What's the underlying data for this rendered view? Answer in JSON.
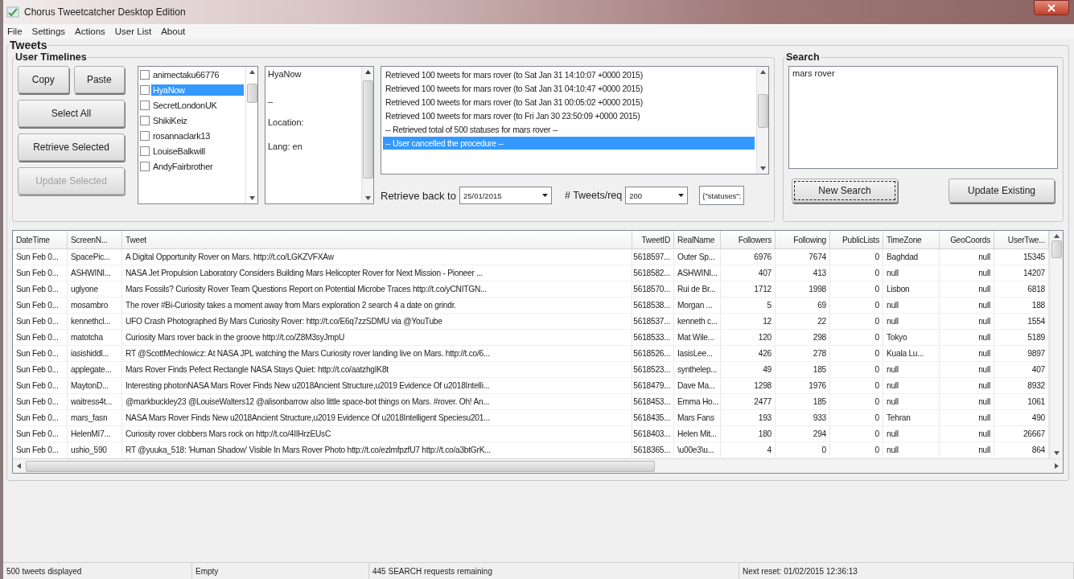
{
  "window": {
    "title": "Chorus Tweetcatcher Desktop Edition"
  },
  "menu": [
    {
      "label": "File"
    },
    {
      "label": "Settings"
    },
    {
      "label": "Actions"
    },
    {
      "label": "User List"
    },
    {
      "label": "About"
    }
  ],
  "tweets_group": {
    "title": "Tweets"
  },
  "user_timelines": {
    "title": "User Timelines",
    "buttons": [
      {
        "label": "Copy",
        "disabled": false
      },
      {
        "label": "Paste",
        "disabled": false
      },
      {
        "label": "Select All",
        "disabled": false
      },
      {
        "label": "Retrieve Selected",
        "disabled": false
      },
      {
        "label": "Update Selected",
        "disabled": true
      }
    ],
    "users": [
      {
        "name": "animectaku66776",
        "checked": false,
        "selected": false
      },
      {
        "name": "HyaNow",
        "checked": false,
        "selected": true
      },
      {
        "name": "SecretLondonUK",
        "checked": false,
        "selected": false
      },
      {
        "name": "ShikiKeiz",
        "checked": false,
        "selected": false
      },
      {
        "name": "rosannaclark13",
        "checked": false,
        "selected": false
      },
      {
        "name": "LouiseBalkwill",
        "checked": false,
        "selected": false
      },
      {
        "name": "AndyFairbrother",
        "checked": false,
        "selected": false
      }
    ],
    "details": [
      "HyaNow",
      "_",
      "Location:",
      "Lang: en"
    ]
  },
  "log": [
    {
      "text": "Retrieved 100 tweets for mars rover (to Sat Jan 31 14:10:07 +0000 2015)",
      "selected": false
    },
    {
      "text": "Retrieved 100 tweets for mars rover (to Sat Jan 31 04:10:47 +0000 2015)",
      "selected": false
    },
    {
      "text": "Retrieved 100 tweets for mars rover (to Sat Jan 31 00:05:02 +0000 2015)",
      "selected": false
    },
    {
      "text": "Retrieved 100 tweets for mars rover (to Fri Jan 30 23:50:09 +0000 2015)",
      "selected": false
    },
    {
      "text": "-- Retrieved total of 500 statuses for mars rover --",
      "selected": false
    },
    {
      "text": "-- User cancelled the procedure --",
      "selected": true
    }
  ],
  "retrieve_back": {
    "label": "Retrieve back to",
    "value": "25/01/2015"
  },
  "tweets_per_request": {
    "label": "# Tweets/req",
    "value": "200"
  },
  "json_field": {
    "value": "{\"statuses\":"
  },
  "search": {
    "title": "Search",
    "query": "mars rover",
    "buttons": [
      {
        "label": "New Search",
        "focused": true
      },
      {
        "label": "Update Existing",
        "focused": false
      }
    ]
  },
  "table": {
    "columns": [
      {
        "label": "DateTime"
      },
      {
        "label": "ScreenN..."
      },
      {
        "label": "Tweet"
      },
      {
        "label": "TweetID"
      },
      {
        "label": "RealName"
      },
      {
        "label": "Followers"
      },
      {
        "label": "Following"
      },
      {
        "label": "PublicLists"
      },
      {
        "label": "TimeZone"
      },
      {
        "label": "GeoCoords"
      },
      {
        "label": "UserTwe..."
      }
    ],
    "rows": [
      {
        "cells": [
          "Sun Feb 0...",
          "SpacePic...",
          "A Digital Opportunity Rover on Mars. http://t.co/LGKZVFXAw",
          "5618597...",
          "Outer Sp...",
          "6976",
          "7674",
          "0",
          "Baghdad",
          "null",
          "15345"
        ]
      },
      {
        "cells": [
          "Sun Feb 0...",
          "ASHWINI...",
          "NASA Jet Propulsion Laboratory Considers Building Mars Helicopter Rover for Next Mission - Pioneer ...",
          "5618582...",
          "ASHWINI...",
          "407",
          "413",
          "0",
          "null",
          "null",
          "14207"
        ]
      },
      {
        "cells": [
          "Sun Feb 0...",
          "uglyone",
          "Mars Fossils? Curiosity Rover Team Questions Report on Potential Microbe Traces http://t.co/yCNITGN...",
          "5618570...",
          "Rui de Br...",
          "1712",
          "1998",
          "0",
          "Lisbon",
          "null",
          "6818"
        ]
      },
      {
        "cells": [
          "Sun Feb 0...",
          "mosambro",
          "The rover #Bi-Curiosity takes a moment away from Mars exploration 2 search 4 a date on grindr.",
          "5618538...",
          "Morgan ...",
          "5",
          "69",
          "0",
          "null",
          "null",
          "188"
        ]
      },
      {
        "cells": [
          "Sun Feb 0...",
          "kennethcl...",
          "UFO Crash Photographed By Mars Curiosity Rover: http://t.co/E6q7zzSDMU via @YouTube",
          "5618537...",
          "kenneth c...",
          "12",
          "22",
          "0",
          "null",
          "null",
          "1554"
        ]
      },
      {
        "cells": [
          "Sun Feb 0...",
          "matotcha",
          "Curiosity Mars rover back in the groove http://t.co/Z8M3syJmpU",
          "5618533...",
          "Mat Wile...",
          "120",
          "298",
          "0",
          "Tokyo",
          "null",
          "5189"
        ]
      },
      {
        "cells": [
          "Sun Feb 0...",
          "iasishiddl...",
          "RT @ScottMechlowicz: At NASA JPL watching the Mars Curiosity rover landing live on Mars. http://t.co/6...",
          "5618526...",
          "IasisLee...",
          "426",
          "278",
          "0",
          "Kuala Lu...",
          "null",
          "9897"
        ]
      },
      {
        "cells": [
          "Sun Feb 0...",
          "applegate...",
          "Mars Rover Finds Pefect Rectangle NASA Stays Quiet: http://t.co/aatzhgIK8t",
          "5618523...",
          "synthelep...",
          "49",
          "185",
          "0",
          "null",
          "null",
          "407"
        ]
      },
      {
        "cells": [
          "Sun Feb 0...",
          "MaytonD...",
          "Interesting photonNASA Mars Rover Finds New u2018Ancient Structure,u2019 Evidence Of u2018Intelli...",
          "5618479...",
          "Dave Ma...",
          "1298",
          "1976",
          "0",
          "null",
          "null",
          "8932"
        ]
      },
      {
        "cells": [
          "Sun Feb 0...",
          "waitress4t...",
          "@markbuckley23 @LouiseWalters12 @alisonbarrow also little space-bot things on Mars. #rover. Oh! An...",
          "5618453...",
          "Emma Ho...",
          "2477",
          "185",
          "0",
          "null",
          "null",
          "1061"
        ]
      },
      {
        "cells": [
          "Sun Feb 0...",
          "mars_fasn",
          "NASA Mars Rover Finds New u2018Ancient Structure,u2019 Evidence Of u2018Intelligent Speciesu201...",
          "5618435...",
          "Mars Fans",
          "193",
          "933",
          "0",
          "Tehran",
          "null",
          "490"
        ]
      },
      {
        "cells": [
          "Sun Feb 0...",
          "HelenMI7...",
          "Curiosity rover clobbers Mars rock on http://t.co/4IIHrzEUsC",
          "5618403...",
          "Helen Mit...",
          "180",
          "294",
          "0",
          "null",
          "null",
          "26667"
        ]
      },
      {
        "cells": [
          "Sun Feb 0...",
          "ushio_590",
          "RT @yuuka_518: 'Human Shadow' Visible In Mars Rover Photo http://t.co/ezlmfpzfU7 http://t.co/a3btGrK...",
          "5618365...",
          "\\u00e3\\u...",
          "4",
          "0",
          "0",
          "null",
          "null",
          "864"
        ]
      }
    ]
  },
  "status_bar": [
    "500 tweets displayed",
    "Empty",
    "445 SEARCH requests remaining",
    "Next reset: 01/02/2015 12:36:13"
  ]
}
